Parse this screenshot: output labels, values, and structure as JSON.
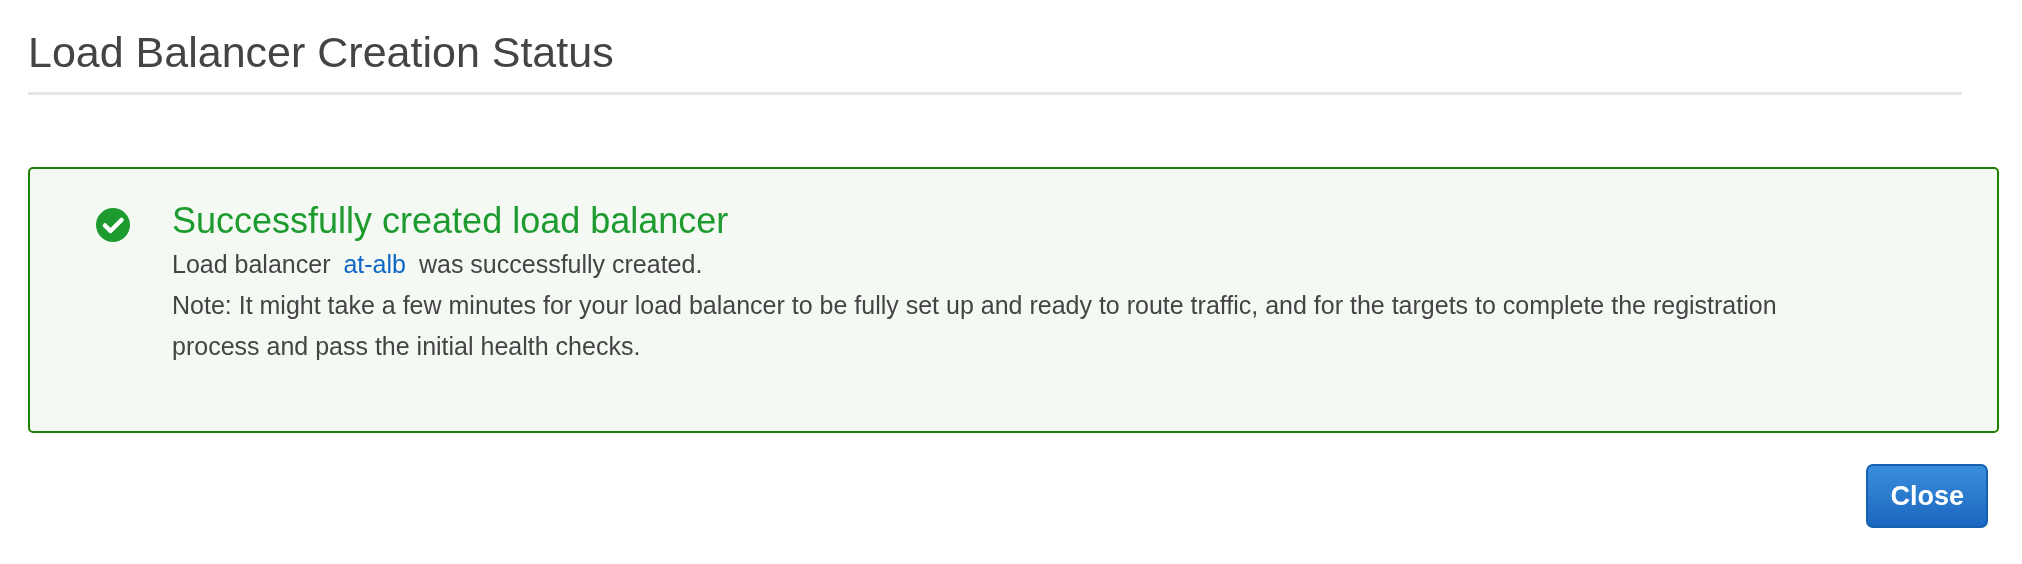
{
  "title": "Load Balancer Creation Status",
  "alert": {
    "kind": "success",
    "heading": "Successfully created load balancer",
    "message": {
      "before": "Load balancer",
      "link": "at-alb",
      "after": "was successfully created."
    },
    "note": "Note: It might take a few minutes for your load balancer to be fully set up and ready to route traffic, and for the targets to complete the registration process and pass the initial health checks."
  },
  "buttons": [
    "Close"
  ]
}
